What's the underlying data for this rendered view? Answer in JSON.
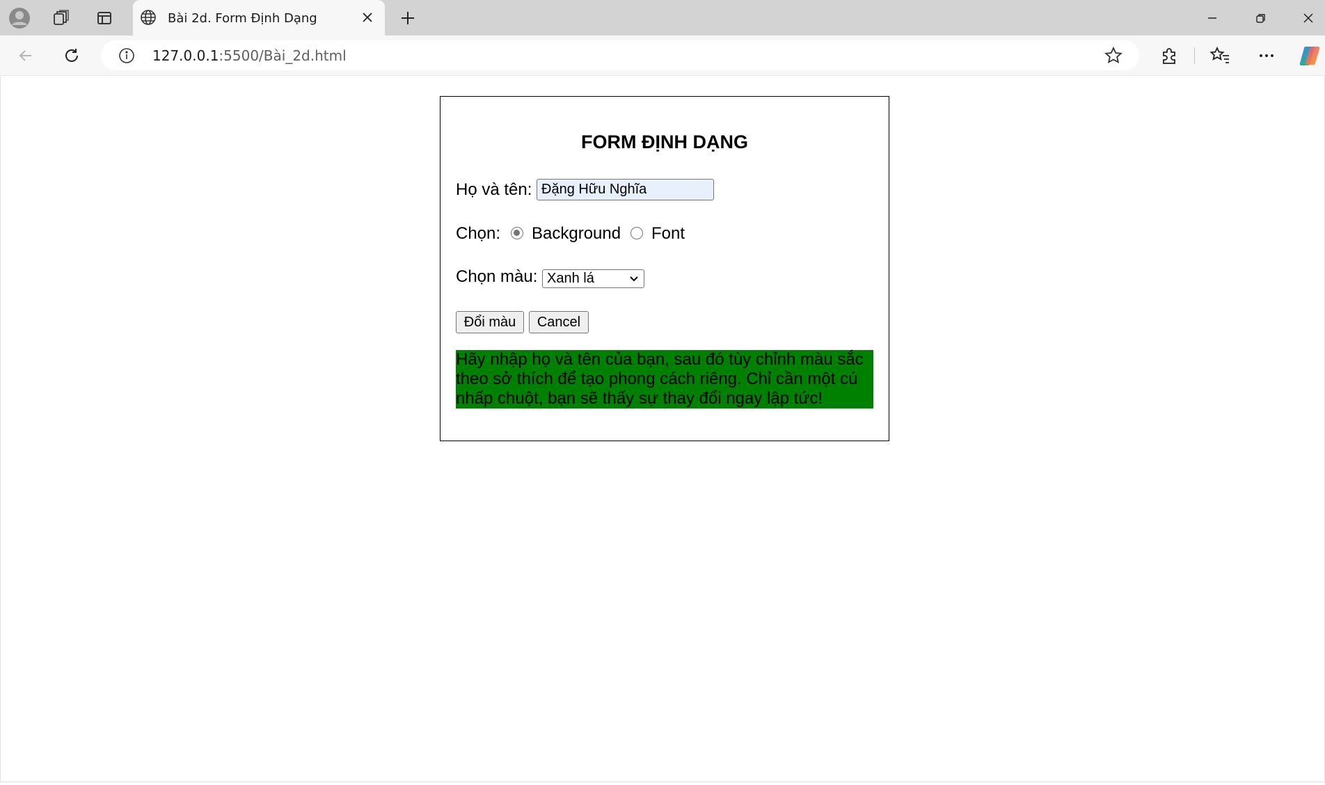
{
  "browser": {
    "tab_title": "Bài 2d. Form Định Dạng",
    "url_host": "127.0.0.1",
    "url_path": ":5500/Bài_2d.html"
  },
  "form": {
    "title": "FORM ĐỊNH DẠNG",
    "name_label": "Họ và tên:",
    "name_value": "Đặng Hữu Nghĩa",
    "choose_label": "Chọn:",
    "radio_background_label": "Background",
    "radio_font_label": "Font",
    "selected_radio": "Background",
    "color_label": "Chọn màu:",
    "color_selected": "Xanh lá",
    "change_button": "Đổi màu",
    "cancel_button": "Cancel",
    "note_text": "Hãy nhập họ và tên của bạn, sau đó tùy chỉnh màu sắc theo sở thích để tạo phong cách riêng. Chỉ cần một cú nhấp chuột, bạn sẽ thấy sự thay đổi ngay lập tức!",
    "note_background": "#008000"
  },
  "icons": {
    "profile": "profile-icon",
    "workspaces": "workspaces-icon",
    "tab_actions": "tab-actions-icon",
    "site": "globe-icon",
    "close_tab": "close-icon",
    "new_tab": "plus-icon",
    "minimize": "minimize-icon",
    "restore": "restore-icon",
    "close_window": "close-icon",
    "back": "back-arrow-icon",
    "refresh": "refresh-icon",
    "info": "info-icon",
    "favorite": "star-icon",
    "extensions": "puzzle-icon",
    "favorites": "favorites-icon",
    "more": "more-icon",
    "copilot": "copilot-icon"
  }
}
